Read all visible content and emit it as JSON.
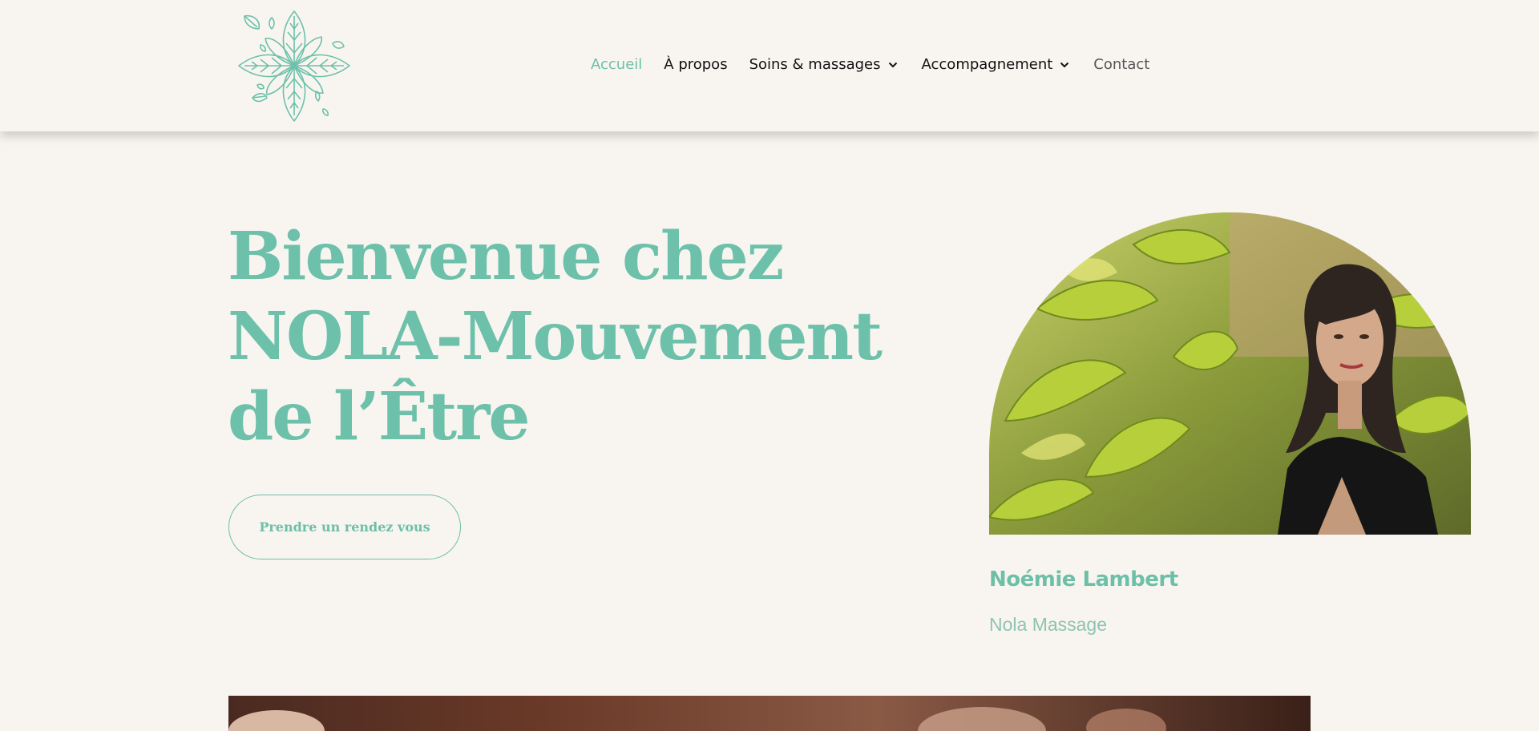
{
  "header": {
    "logo_icon": "leaf-mandala-icon",
    "nav": [
      {
        "label": "Accueil",
        "state": "active"
      },
      {
        "label": "À propos"
      },
      {
        "label": "Soins & massages",
        "dropdown": true
      },
      {
        "label": "Accompagnement",
        "dropdown": true
      },
      {
        "label": "Contact"
      }
    ]
  },
  "hero": {
    "title_lines": [
      "Bienvenue chez",
      "NOLA-Mouvement",
      "de l’Être"
    ],
    "cta_label": "Prendre un rendez vous"
  },
  "profile": {
    "name": "Noémie Lambert",
    "brand": "Nola Massage"
  },
  "colors": {
    "accent": "#6dbfa8",
    "background": "#f8f5f1",
    "text": "#111111"
  }
}
